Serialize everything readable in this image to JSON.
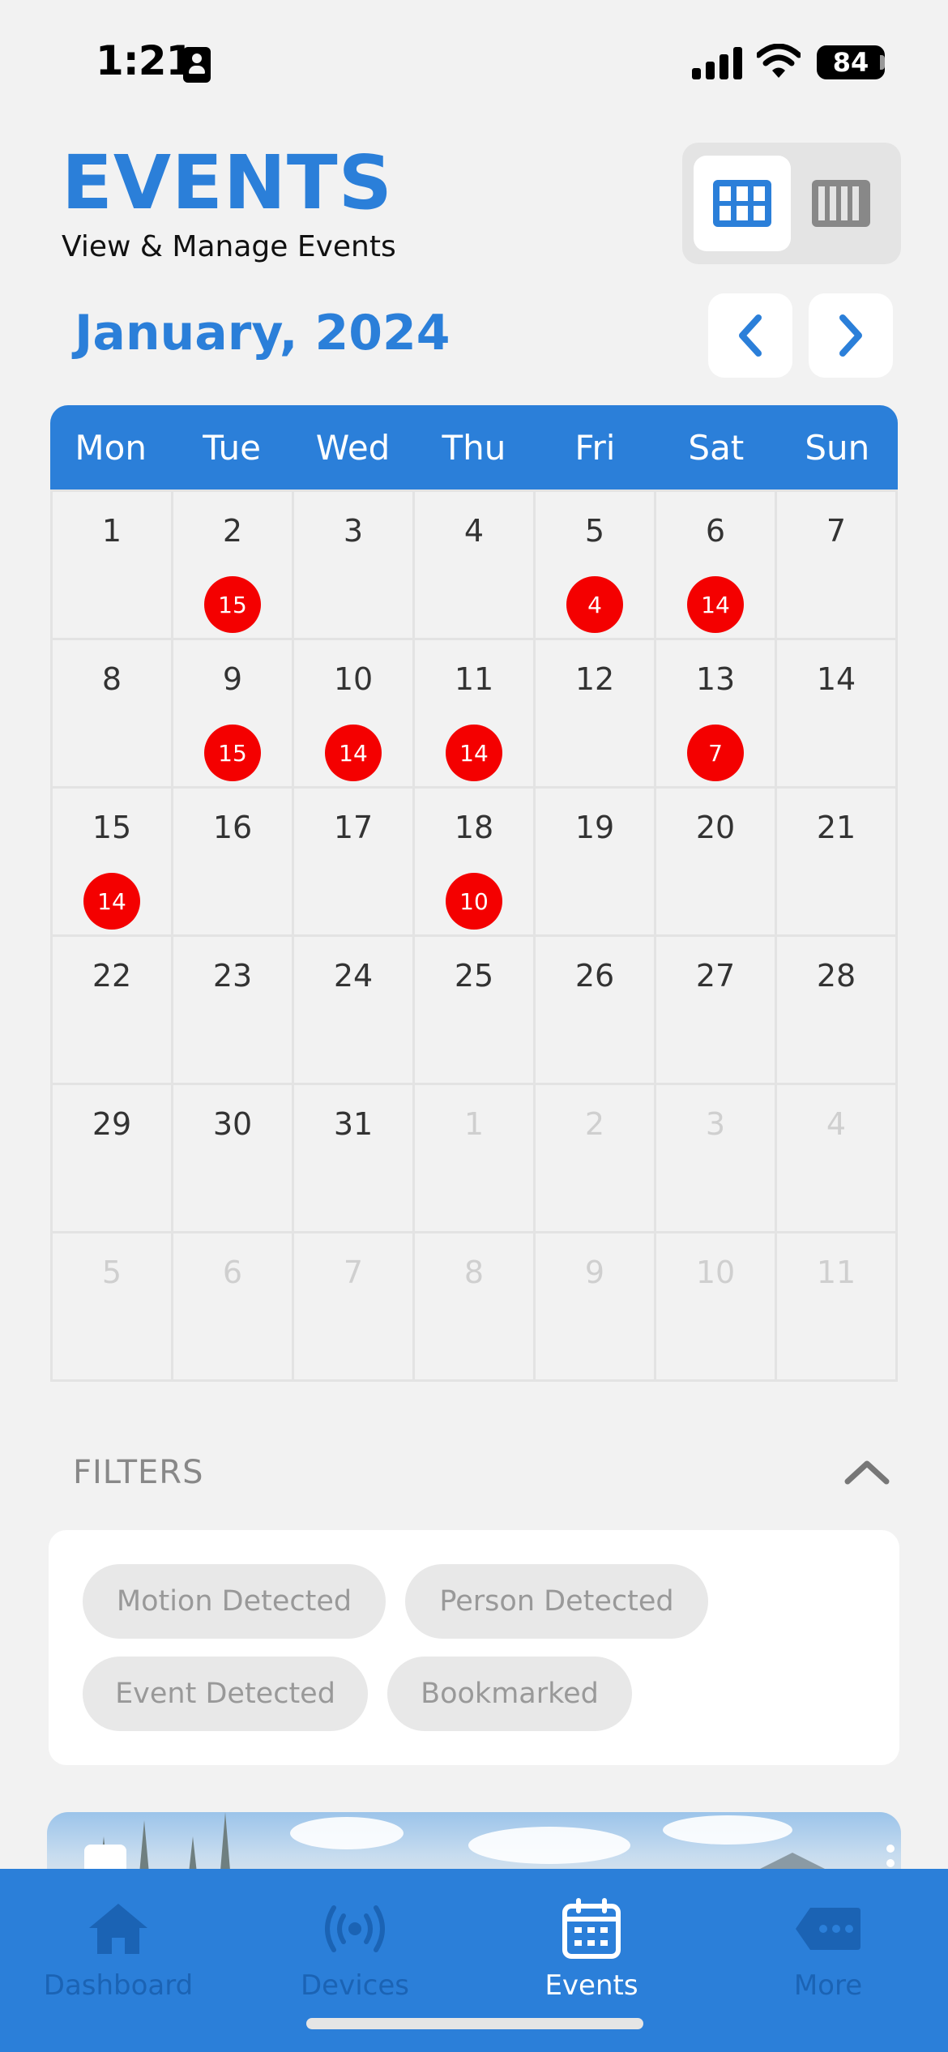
{
  "status_bar": {
    "time": "1:21",
    "battery": "84"
  },
  "header": {
    "title": "EVENTS",
    "subtitle": "View & Manage Events"
  },
  "calendar": {
    "month_label": "January, 2024",
    "weekdays": [
      "Mon",
      "Tue",
      "Wed",
      "Thu",
      "Fri",
      "Sat",
      "Sun"
    ],
    "weeks": [
      [
        {
          "day": "1"
        },
        {
          "day": "2",
          "count": "15"
        },
        {
          "day": "3"
        },
        {
          "day": "4"
        },
        {
          "day": "5",
          "count": "4"
        },
        {
          "day": "6",
          "count": "14"
        },
        {
          "day": "7"
        }
      ],
      [
        {
          "day": "8"
        },
        {
          "day": "9",
          "count": "15"
        },
        {
          "day": "10",
          "count": "14"
        },
        {
          "day": "11",
          "count": "14"
        },
        {
          "day": "12"
        },
        {
          "day": "13",
          "count": "7"
        },
        {
          "day": "14"
        }
      ],
      [
        {
          "day": "15",
          "count": "14"
        },
        {
          "day": "16"
        },
        {
          "day": "17"
        },
        {
          "day": "18",
          "count": "10"
        },
        {
          "day": "19"
        },
        {
          "day": "20"
        },
        {
          "day": "21"
        }
      ],
      [
        {
          "day": "22"
        },
        {
          "day": "23"
        },
        {
          "day": "24"
        },
        {
          "day": "25"
        },
        {
          "day": "26"
        },
        {
          "day": "27"
        },
        {
          "day": "28"
        }
      ],
      [
        {
          "day": "29"
        },
        {
          "day": "30"
        },
        {
          "day": "31"
        },
        {
          "day": "1",
          "muted": true
        },
        {
          "day": "2",
          "muted": true
        },
        {
          "day": "3",
          "muted": true
        },
        {
          "day": "4",
          "muted": true
        }
      ],
      [
        {
          "day": "5",
          "muted": true
        },
        {
          "day": "6",
          "muted": true
        },
        {
          "day": "7",
          "muted": true
        },
        {
          "day": "8",
          "muted": true
        },
        {
          "day": "9",
          "muted": true
        },
        {
          "day": "10",
          "muted": true
        },
        {
          "day": "11",
          "muted": true
        }
      ]
    ]
  },
  "filters": {
    "label": "FILTERS",
    "chips": [
      "Motion Detected",
      "Person Detected",
      "Event Detected",
      "Bookmarked"
    ]
  },
  "tabbar": {
    "tabs": [
      {
        "label": "Dashboard",
        "icon": "home-icon",
        "active": false
      },
      {
        "label": "Devices",
        "icon": "broadcast-icon",
        "active": false
      },
      {
        "label": "Events",
        "icon": "calendar-icon",
        "active": true
      },
      {
        "label": "More",
        "icon": "more-icon",
        "active": false
      }
    ]
  },
  "colors": {
    "accent": "#2b7fd9",
    "badge": "#f40000",
    "background": "#f2f2f2"
  }
}
